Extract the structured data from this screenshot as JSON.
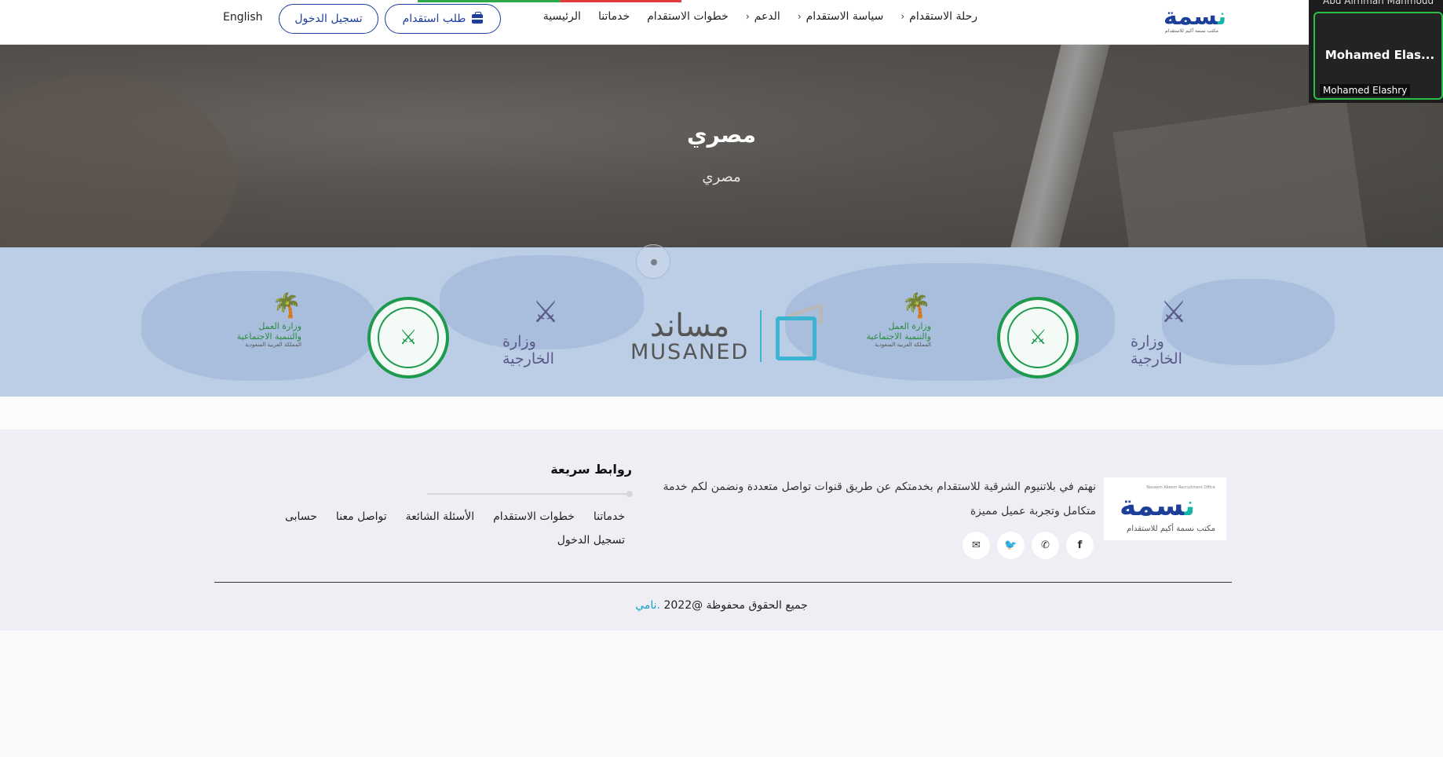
{
  "nav": {
    "items": [
      {
        "label": "الرئيسية",
        "has_menu": false
      },
      {
        "label": "خدماتنا",
        "has_menu": false
      },
      {
        "label": "خطوات الاستقدام",
        "has_menu": false
      },
      {
        "label": "الدعم",
        "has_menu": true
      },
      {
        "label": "سياسة الاستقدام",
        "has_menu": true
      },
      {
        "label": "رحلة الاستقدام",
        "has_menu": true
      }
    ],
    "request_button": "طلب استقدام",
    "login_button": "تسجيل الدخول",
    "language": "English",
    "logo_text_a": "ن",
    "logo_text_b": "سمة",
    "logo_sub": "مكتب نسمة أكيم للاستقدام"
  },
  "hero": {
    "title": "مصري",
    "subtitle": "مصري"
  },
  "partners": {
    "mofa_text": "وزارة الخارجية",
    "hrsd_line1": "وزارة العمل",
    "hrsd_line2": "والتنمية الاجتماعية",
    "hrsd_line3": "المملكة العربية السعودية",
    "musaned_ar": "مساند",
    "musaned_en": "MUSANED"
  },
  "footer": {
    "logo_text_a": "ن",
    "logo_text_b": "سمة",
    "logo_top": "Naseem Akeem Recruitment Office",
    "logo_sub": "مكتب نسمة أكيم للاستقدام",
    "description": "نهتم في بلاتنيوم الشرقية للاستقدام بخدمتكم عن طريق قنوات تواصل متعددة ونضمن لكم خدمة متكامل وتجربة عميل مميزة",
    "quick_links_title": "روابط سريعة",
    "quick_links": [
      "خدماتنا",
      "خطوات الاستقدام",
      "الأسئلة الشائعة",
      "تواصل معنا",
      "حسابى",
      "تسجيل الدخول"
    ],
    "copyright_text": "جميع الحقوق محفوظة @2022",
    "copyright_brand": ".نامي"
  },
  "video_call": {
    "top_name": "Abd Alrhman Mahmoud",
    "tile_name": "Mohamed Elas...",
    "tile_label": "Mohamed Elashry"
  }
}
